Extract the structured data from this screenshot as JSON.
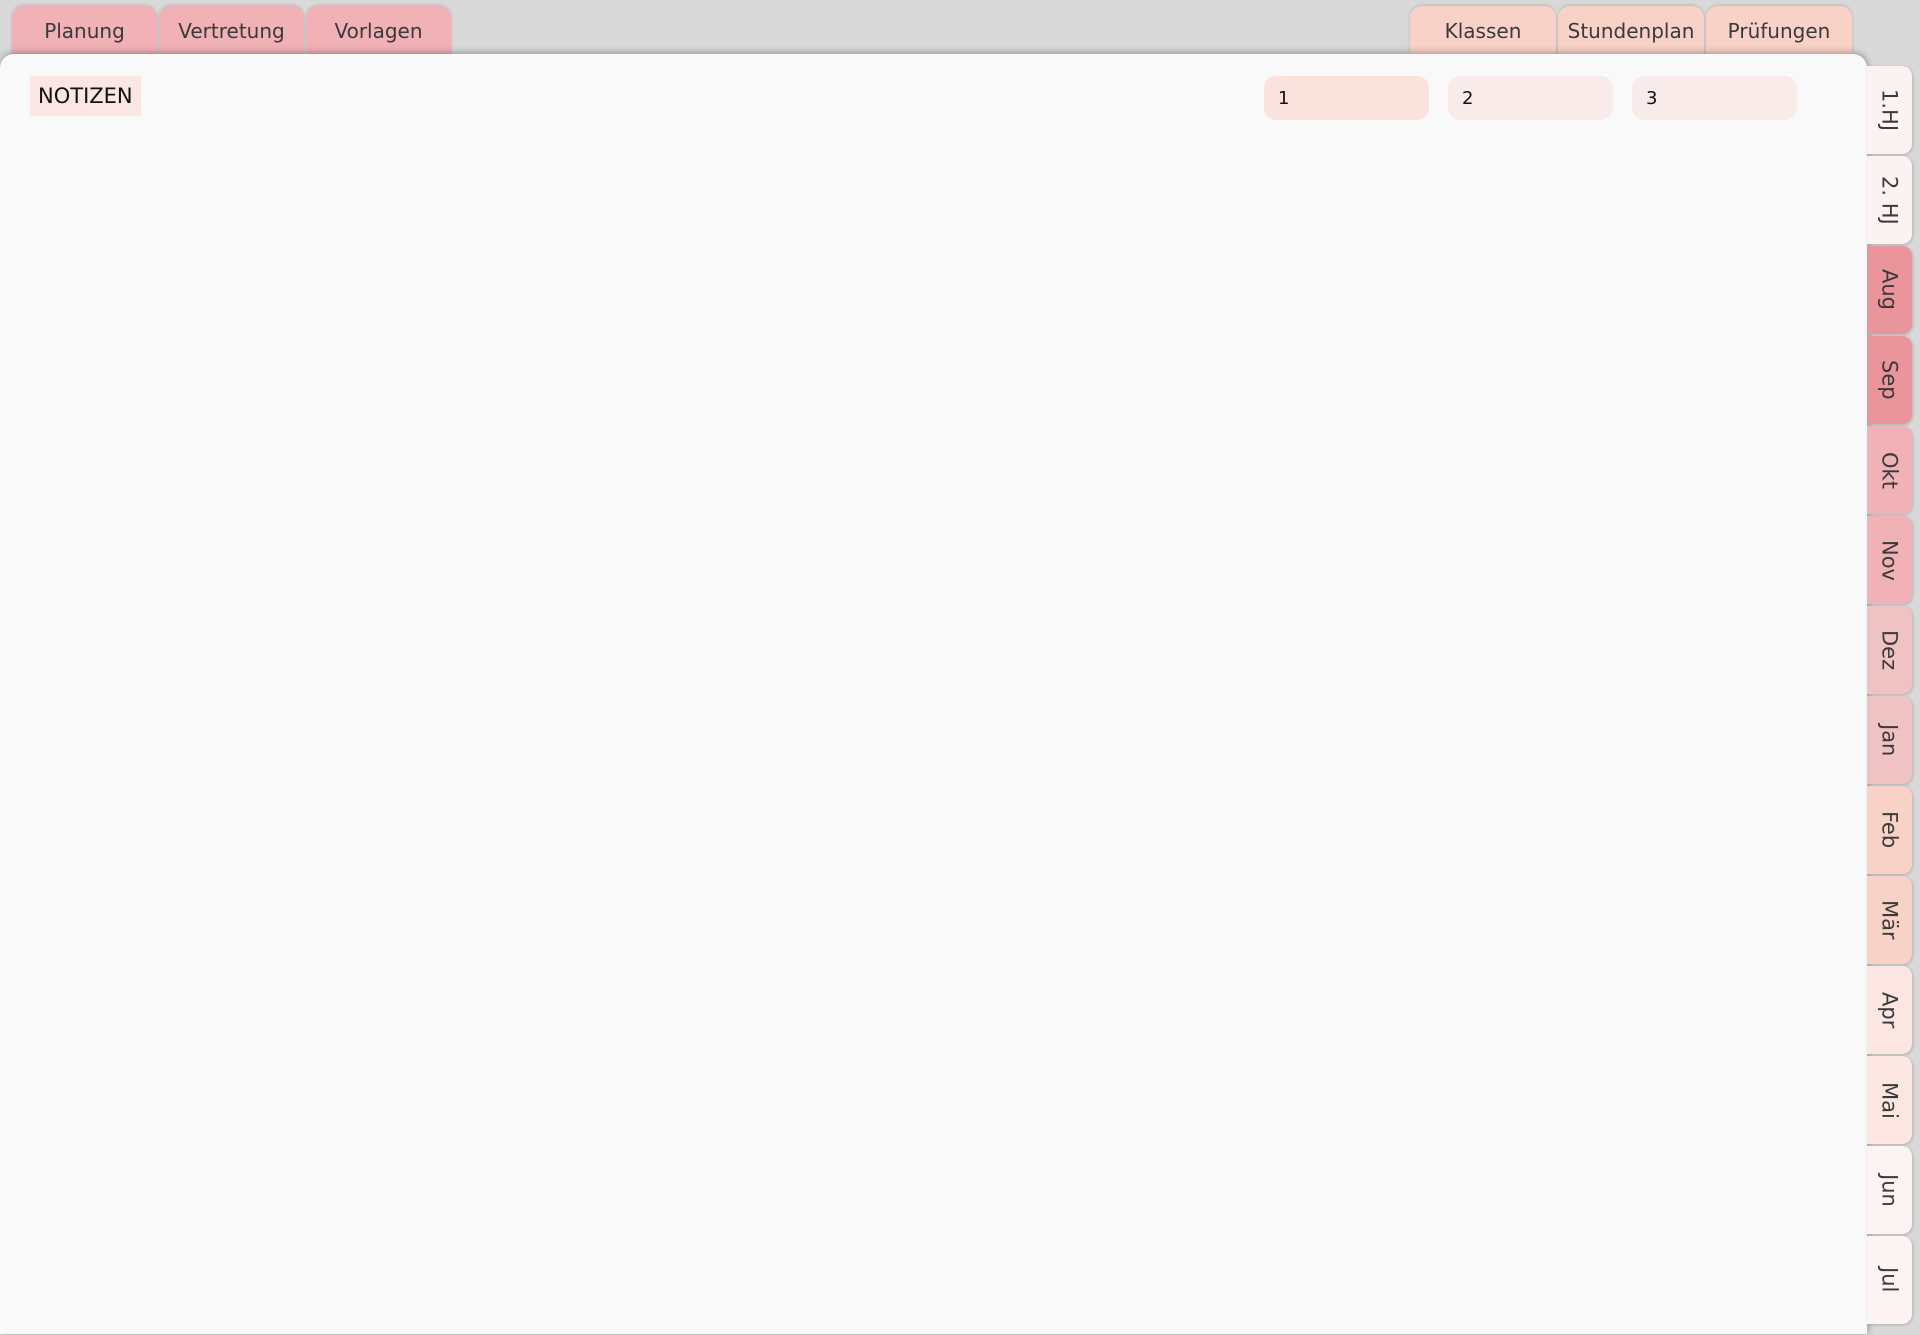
{
  "top_tabs_left": [
    {
      "label": "Planung",
      "color": "#f0b2b6"
    },
    {
      "label": "Vertretung",
      "color": "#f0b2b6"
    },
    {
      "label": "Vorlagen",
      "color": "#f0b2b6"
    }
  ],
  "top_tabs_right": [
    {
      "label": "Klassen",
      "color": "#f9d2c7"
    },
    {
      "label": "Stundenplan",
      "color": "#f9d2c7"
    },
    {
      "label": "Prüfungen",
      "color": "#f9d2c7"
    }
  ],
  "notes": {
    "title": "NOTIZEN",
    "pages": [
      {
        "label": "1",
        "color": "#fbe3dd"
      },
      {
        "label": "2",
        "color": "#f9ebea"
      },
      {
        "label": "3",
        "color": "#f9ebea"
      }
    ]
  },
  "side_tabs": [
    {
      "label": "1.HJ",
      "color": "#fbf3f2"
    },
    {
      "label": "2. HJ",
      "color": "#fbf3f2"
    },
    {
      "label": "Aug",
      "color": "#e9959b"
    },
    {
      "label": "Sep",
      "color": "#e9959b"
    },
    {
      "label": "Okt",
      "color": "#f0b2b6"
    },
    {
      "label": "Nov",
      "color": "#f0b2b6"
    },
    {
      "label": "Dez",
      "color": "#efc2c4"
    },
    {
      "label": "Jan",
      "color": "#efc2c4"
    },
    {
      "label": "Feb",
      "color": "#f9d2c7"
    },
    {
      "label": "Mär",
      "color": "#f9d2c7"
    },
    {
      "label": "Apr",
      "color": "#fbe6e2"
    },
    {
      "label": "Mai",
      "color": "#fbe6e2"
    },
    {
      "label": "Jun",
      "color": "#fcf4f3"
    },
    {
      "label": "Jul",
      "color": "#fcf4f3"
    }
  ]
}
